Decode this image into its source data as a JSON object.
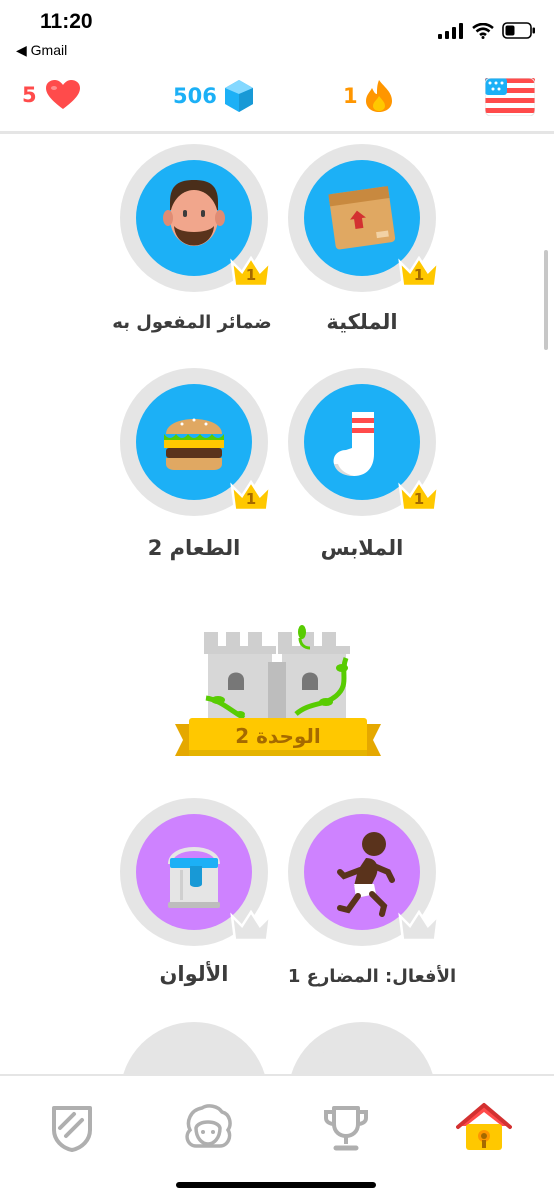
{
  "status_bar": {
    "time": "11:20",
    "back_label": "◀ Gmail"
  },
  "stats": {
    "hearts": "5",
    "gems": "506",
    "streak": "1",
    "course_flag_icon": "us-flag-icon"
  },
  "skills": [
    {
      "label": "الملكية",
      "crown_level": "1",
      "icon": "package-icon",
      "color": "#1cb0f6"
    },
    {
      "label": "ضمائر المفعول به",
      "crown_level": "1",
      "icon": "bearded-man-icon",
      "color": "#1cb0f6"
    },
    {
      "label": "الملابس",
      "crown_level": "1",
      "icon": "sock-icon",
      "color": "#1cb0f6"
    },
    {
      "label": "الطعام 2",
      "crown_level": "1",
      "icon": "burger-icon",
      "color": "#1cb0f6"
    },
    {
      "label": "الأفعال: المضارع 1",
      "icon": "running-figure-icon",
      "color": "#ce82ff"
    },
    {
      "label": "الألوان",
      "icon": "paint-bucket-icon",
      "color": "#ce82ff"
    }
  ],
  "unit": {
    "label": "الوحدة 2"
  },
  "tabs": [
    {
      "name": "shield-tab"
    },
    {
      "name": "profile-tab"
    },
    {
      "name": "leaderboard-tab"
    },
    {
      "name": "home-tab",
      "active": true
    }
  ],
  "colors": {
    "heart": "#ff4b4b",
    "gem": "#1cb0f6",
    "streak": "#ff9600",
    "crown": "#ffc800",
    "locked_crown": "#e5e5e5"
  }
}
